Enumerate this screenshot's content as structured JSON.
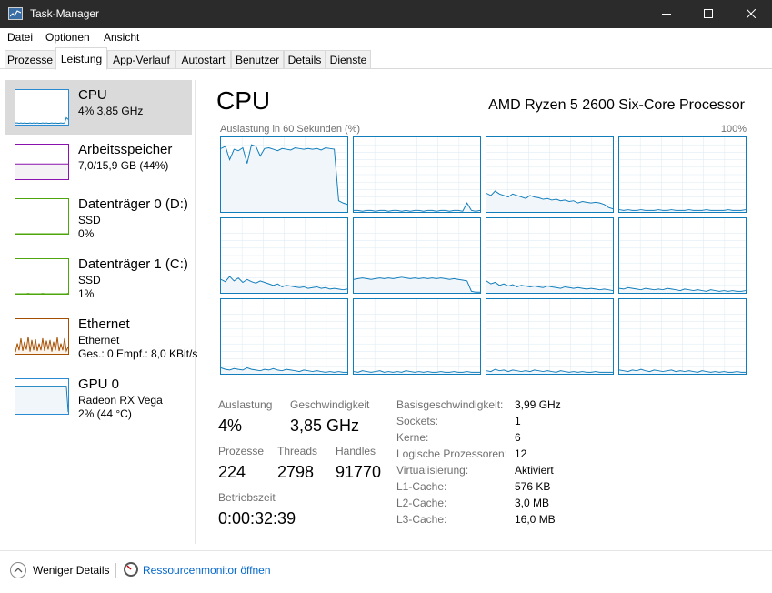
{
  "window": {
    "title": "Task-Manager",
    "icon": "task-manager-icon"
  },
  "menu": [
    "Datei",
    "Optionen",
    "Ansicht"
  ],
  "tabs": [
    "Prozesse",
    "Leistung",
    "App-Verlauf",
    "Autostart",
    "Benutzer",
    "Details",
    "Dienste"
  ],
  "active_tab": "Leistung",
  "sidebar": [
    {
      "title": "CPU",
      "sub1": "4% 3,85 GHz",
      "sub2": "",
      "sub3": "",
      "color": "#117dbb"
    },
    {
      "title": "Arbeitsspeicher",
      "sub1": "7,0/15,9 GB (44%)",
      "sub2": "",
      "sub3": "",
      "color": "#8b12ae"
    },
    {
      "title": "Datenträger 0 (D:)",
      "sub1": "SSD",
      "sub2": "0%",
      "sub3": "",
      "color": "#4da60c"
    },
    {
      "title": "Datenträger 1 (C:)",
      "sub1": "SSD",
      "sub2": "1%",
      "sub3": "",
      "color": "#4da60c"
    },
    {
      "title": "Ethernet",
      "sub1": "Ethernet",
      "sub2": "Ges.: 0  Empf.: 8,0 KBit/s",
      "sub3": "",
      "color": "#a74f01"
    },
    {
      "title": "GPU 0",
      "sub1": "Radeon RX Vega",
      "sub2": "2% (44 °C)",
      "sub3": "",
      "color": "#117dbb"
    }
  ],
  "main": {
    "title": "CPU",
    "processor": "AMD Ryzen 5 2600 Six-Core Processor",
    "graph_label": "Auslastung in 60 Sekunden (%)",
    "graph_max": "100%",
    "stats": {
      "util_label": "Auslastung",
      "util_value": "4%",
      "speed_label": "Geschwindigkeit",
      "speed_value": "3,85 GHz",
      "proc_label": "Prozesse",
      "proc_value": "224",
      "threads_label": "Threads",
      "threads_value": "2798",
      "handles_label": "Handles",
      "handles_value": "91770",
      "uptime_label": "Betriebszeit",
      "uptime_value": "0:00:32:39"
    },
    "info": [
      {
        "label": "Basisgeschwindigkeit:",
        "value": "3,99 GHz"
      },
      {
        "label": "Sockets:",
        "value": "1"
      },
      {
        "label": "Kerne:",
        "value": "6"
      },
      {
        "label": "Logische Prozessoren:",
        "value": "12"
      },
      {
        "label": "Virtualisierung:",
        "value": "Aktiviert"
      },
      {
        "label": "L1-Cache:",
        "value": "576 KB"
      },
      {
        "label": "L2-Cache:",
        "value": "3,0 MB"
      },
      {
        "label": "L3-Cache:",
        "value": "16,0 MB"
      }
    ]
  },
  "footer": {
    "fewer_details": "Weniger Details",
    "resource_monitor": "Ressourcenmonitor öffnen"
  },
  "colors": {
    "cpu": "#117dbb",
    "cpu_fill": "#f1f6fa",
    "memory": "#8b12ae",
    "disk": "#4da60c",
    "ethernet": "#a74f01",
    "selected": "#dadada",
    "link": "#0066cc"
  },
  "cpu_cores": [
    [
      85,
      88,
      70,
      84,
      82,
      86,
      65,
      90,
      88,
      75,
      85,
      86,
      84,
      82,
      85,
      84,
      83,
      86,
      85,
      84,
      85,
      84,
      85,
      83,
      86,
      85,
      84,
      15,
      12,
      10
    ],
    [
      2,
      2,
      1,
      2,
      2,
      1,
      2,
      2,
      1,
      2,
      2,
      1,
      2,
      1,
      2,
      2,
      1,
      2,
      2,
      1,
      2,
      2,
      1,
      2,
      2,
      1,
      12,
      2,
      1,
      2
    ],
    [
      25,
      22,
      28,
      24,
      22,
      20,
      24,
      22,
      20,
      18,
      22,
      20,
      19,
      17,
      18,
      16,
      17,
      15,
      16,
      14,
      15,
      12,
      14,
      13,
      12,
      13,
      12,
      10,
      6,
      4
    ],
    [
      3,
      2,
      3,
      2,
      2,
      3,
      2,
      2,
      2,
      3,
      2,
      2,
      3,
      2,
      2,
      2,
      3,
      2,
      2,
      2,
      3,
      2,
      2,
      2,
      2,
      3,
      2,
      2,
      2,
      3
    ],
    [
      18,
      15,
      22,
      16,
      20,
      14,
      18,
      15,
      13,
      16,
      14,
      12,
      10,
      12,
      8,
      10,
      9,
      8,
      7,
      8,
      6,
      7,
      8,
      6,
      7,
      5,
      6,
      5,
      4,
      5
    ],
    [
      18,
      19,
      20,
      19,
      18,
      19,
      20,
      19,
      20,
      19,
      20,
      21,
      20,
      19,
      20,
      19,
      20,
      19,
      20,
      19,
      20,
      19,
      18,
      19,
      18,
      17,
      16,
      2,
      1,
      1
    ],
    [
      16,
      12,
      14,
      10,
      12,
      9,
      11,
      8,
      10,
      9,
      8,
      9,
      8,
      7,
      9,
      8,
      7,
      6,
      8,
      7,
      6,
      7,
      6,
      5,
      6,
      5,
      4,
      5,
      4,
      3
    ],
    [
      6,
      5,
      7,
      6,
      5,
      4,
      6,
      5,
      4,
      5,
      4,
      6,
      5,
      4,
      3,
      5,
      4,
      3,
      4,
      3,
      2,
      4,
      3,
      2,
      3,
      2,
      3,
      2,
      2,
      3
    ],
    [
      8,
      6,
      5,
      7,
      6,
      5,
      8,
      6,
      5,
      4,
      6,
      5,
      7,
      5,
      4,
      6,
      5,
      4,
      3,
      5,
      4,
      3,
      4,
      3,
      2,
      3,
      2,
      3,
      2,
      2
    ],
    [
      3,
      2,
      4,
      3,
      2,
      3,
      4,
      2,
      3,
      2,
      3,
      2,
      4,
      3,
      2,
      3,
      2,
      3,
      2,
      2,
      3,
      2,
      2,
      3,
      2,
      2,
      3,
      2,
      2,
      2
    ],
    [
      4,
      3,
      6,
      4,
      5,
      3,
      5,
      4,
      3,
      4,
      3,
      5,
      4,
      3,
      4,
      3,
      2,
      4,
      3,
      2,
      3,
      2,
      3,
      2,
      2,
      3,
      2,
      2,
      2,
      2
    ],
    [
      5,
      4,
      3,
      5,
      4,
      6,
      4,
      3,
      5,
      4,
      3,
      4,
      5,
      3,
      4,
      3,
      4,
      3,
      2,
      4,
      3,
      2,
      3,
      2,
      3,
      2,
      2,
      3,
      2,
      2
    ]
  ],
  "sidebar_graphs": {
    "cpu": [
      5,
      5,
      4,
      5,
      4,
      5,
      4,
      4,
      5,
      4,
      5,
      4,
      5,
      4,
      4,
      5,
      4,
      5,
      4,
      4,
      5,
      4,
      5,
      4,
      4,
      5,
      4,
      5,
      20,
      15
    ],
    "memory": 44,
    "disk0": [
      0,
      0,
      0,
      0,
      0,
      0,
      0,
      0,
      0,
      0,
      0,
      0,
      0,
      0,
      0,
      0,
      0,
      0,
      0,
      0,
      0,
      0,
      0,
      0,
      0,
      0,
      0,
      0,
      0,
      0
    ],
    "disk1": [
      0,
      0,
      0,
      0,
      0,
      0,
      0,
      1,
      0,
      0,
      0,
      0,
      0,
      0,
      0,
      1,
      0,
      0,
      0,
      0,
      0,
      0,
      0,
      0,
      0,
      0,
      0,
      0,
      0,
      1
    ],
    "ethernet": [
      5,
      30,
      10,
      45,
      8,
      35,
      12,
      50,
      6,
      40,
      10,
      42,
      8,
      30,
      10,
      45,
      8,
      38,
      12,
      40,
      6,
      35,
      10,
      48,
      8,
      30,
      10,
      45,
      8,
      20
    ],
    "gpu": [
      80,
      80,
      80,
      80,
      80,
      80,
      80,
      80,
      80,
      80,
      80,
      80,
      80,
      80,
      80,
      80,
      80,
      80,
      80,
      80,
      80,
      80,
      80,
      80,
      80,
      80,
      80,
      80,
      80,
      5
    ]
  }
}
